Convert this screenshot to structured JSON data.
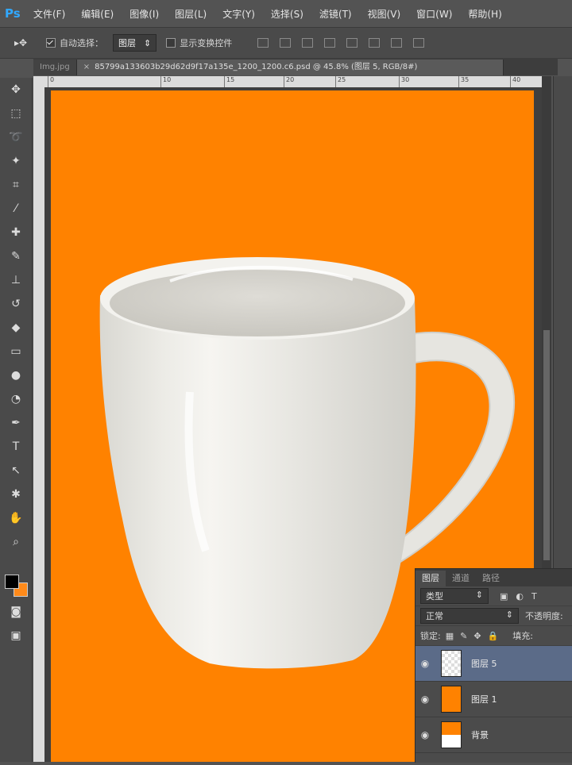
{
  "menubar": {
    "logo": "Ps",
    "items": [
      "文件(F)",
      "编辑(E)",
      "图像(I)",
      "图层(L)",
      "文字(Y)",
      "选择(S)",
      "滤镜(T)",
      "视图(V)",
      "窗口(W)",
      "帮助(H)"
    ]
  },
  "options": {
    "auto_select_label": "自动选择：",
    "auto_select_value": "图层",
    "show_transform_label": "显示变换控件"
  },
  "tabs": {
    "first": "Img.jpg",
    "active": "85799a133603b29d62d9f17a135e_1200_1200.c6.psd @ 45.8% (图层 5, RGB/8#)"
  },
  "ruler": {
    "ticks": [
      "0",
      "10",
      "15",
      "20",
      "25",
      "30",
      "35",
      "40"
    ]
  },
  "layers_panel": {
    "tabs": [
      "图层",
      "通道",
      "路径"
    ],
    "filter_kind": "类型",
    "blend_mode": "正常",
    "opacity_label": "不透明度:",
    "lock_label": "锁定:",
    "fill_label": "填充:",
    "layers": [
      {
        "name": "图层 5",
        "selected": true
      },
      {
        "name": "图层 1",
        "selected": false
      },
      {
        "name": "背景",
        "selected": false
      }
    ]
  },
  "colors": {
    "foreground": "#000000",
    "background": "#ff8a1a",
    "artboard": "#ff8200"
  }
}
